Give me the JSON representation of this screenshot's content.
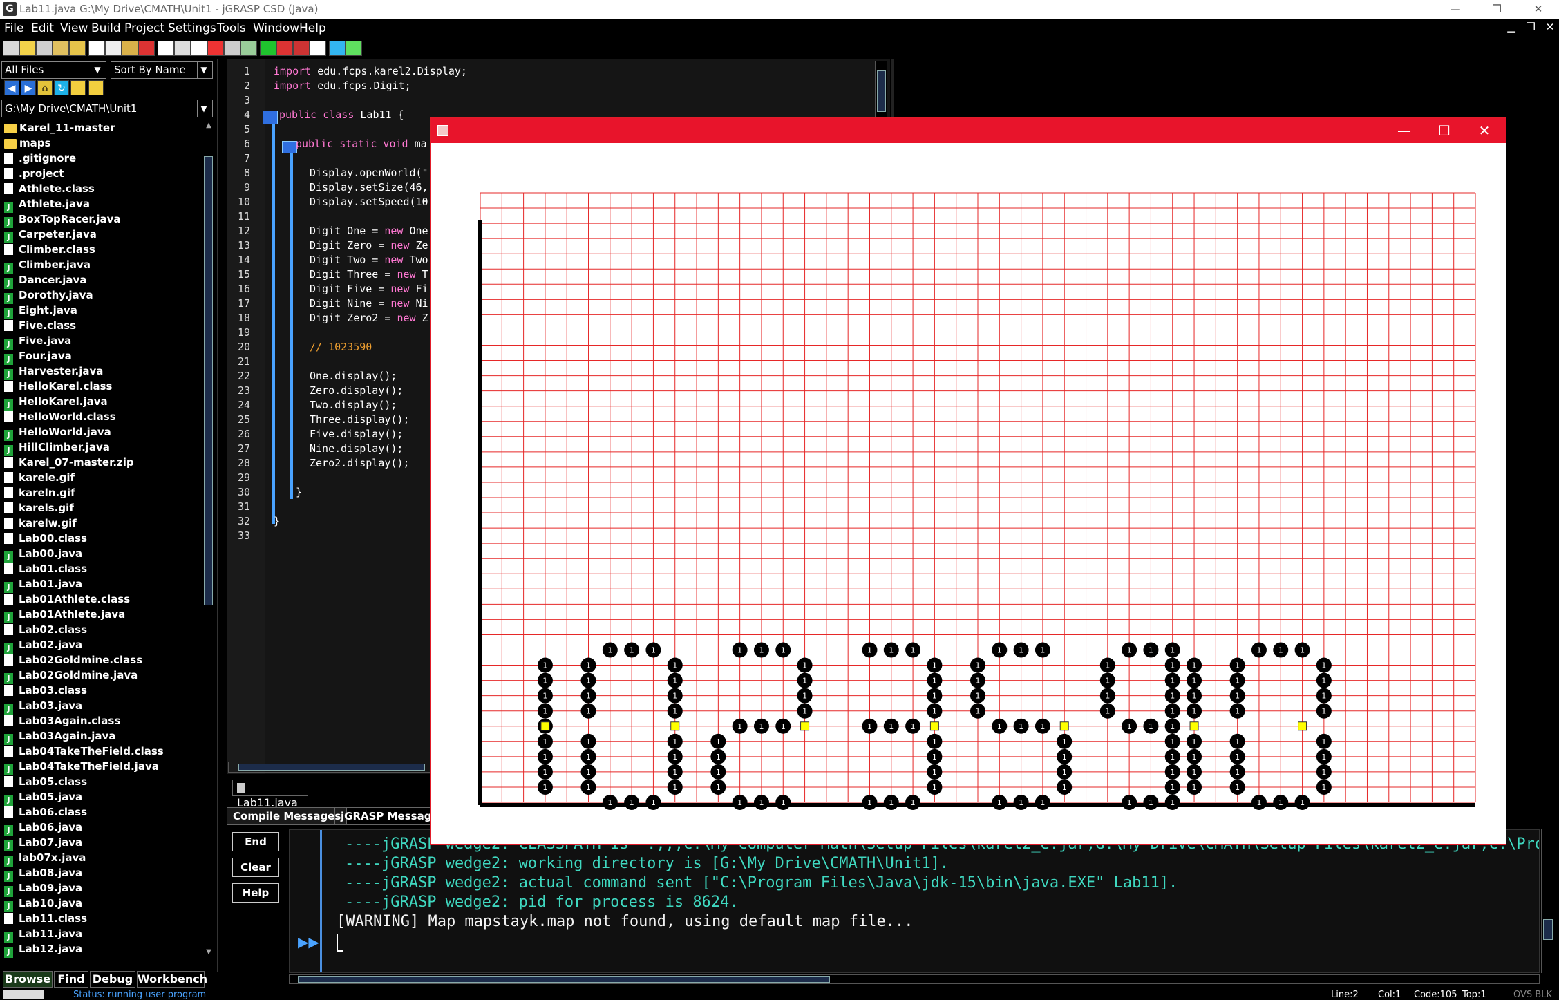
{
  "window": {
    "title": "Lab11.java  G:\\My Drive\\CMATH\\Unit1 - jGRASP CSD (Java)",
    "app_icon": "G",
    "min_icon": "minimize-icon",
    "max_icon": "maximize-icon",
    "close_icon": "close-icon"
  },
  "menu": [
    "File",
    "Edit",
    "View",
    "Build",
    "Project",
    "Settings",
    "Tools",
    "Window",
    "Help"
  ],
  "browse": {
    "filter": "All Files",
    "sort": "Sort By Name",
    "path": "G:\\My Drive\\CMATH\\Unit1",
    "files": [
      {
        "name": "Karel_11-master",
        "type": "folder"
      },
      {
        "name": "maps",
        "type": "folder"
      },
      {
        "name": ".gitignore",
        "type": "doc"
      },
      {
        "name": ".project",
        "type": "doc"
      },
      {
        "name": "Athlete.class",
        "type": "doc"
      },
      {
        "name": "Athlete.java",
        "type": "java"
      },
      {
        "name": "BoxTopRacer.java",
        "type": "java"
      },
      {
        "name": "Carpeter.java",
        "type": "java"
      },
      {
        "name": "Climber.class",
        "type": "doc"
      },
      {
        "name": "Climber.java",
        "type": "java"
      },
      {
        "name": "Dancer.java",
        "type": "java"
      },
      {
        "name": "Dorothy.java",
        "type": "java"
      },
      {
        "name": "Eight.java",
        "type": "java"
      },
      {
        "name": "Five.class",
        "type": "doc"
      },
      {
        "name": "Five.java",
        "type": "java"
      },
      {
        "name": "Four.java",
        "type": "java"
      },
      {
        "name": "Harvester.java",
        "type": "java"
      },
      {
        "name": "HelloKarel.class",
        "type": "doc"
      },
      {
        "name": "HelloKarel.java",
        "type": "java"
      },
      {
        "name": "HelloWorld.class",
        "type": "doc"
      },
      {
        "name": "HelloWorld.java",
        "type": "java"
      },
      {
        "name": "HillClimber.java",
        "type": "java"
      },
      {
        "name": "Karel_07-master.zip",
        "type": "doc"
      },
      {
        "name": "karele.gif",
        "type": "doc"
      },
      {
        "name": "kareln.gif",
        "type": "doc"
      },
      {
        "name": "karels.gif",
        "type": "doc"
      },
      {
        "name": "karelw.gif",
        "type": "doc"
      },
      {
        "name": "Lab00.class",
        "type": "doc"
      },
      {
        "name": "Lab00.java",
        "type": "java"
      },
      {
        "name": "Lab01.class",
        "type": "doc"
      },
      {
        "name": "Lab01.java",
        "type": "java"
      },
      {
        "name": "Lab01Athlete.class",
        "type": "doc"
      },
      {
        "name": "Lab01Athlete.java",
        "type": "java"
      },
      {
        "name": "Lab02.class",
        "type": "doc"
      },
      {
        "name": "Lab02.java",
        "type": "java"
      },
      {
        "name": "Lab02Goldmine.class",
        "type": "doc"
      },
      {
        "name": "Lab02Goldmine.java",
        "type": "java"
      },
      {
        "name": "Lab03.class",
        "type": "doc"
      },
      {
        "name": "Lab03.java",
        "type": "java"
      },
      {
        "name": "Lab03Again.class",
        "type": "doc"
      },
      {
        "name": "Lab03Again.java",
        "type": "java"
      },
      {
        "name": "Lab04TakeTheField.class",
        "type": "doc"
      },
      {
        "name": "Lab04TakeTheField.java",
        "type": "java"
      },
      {
        "name": "Lab05.class",
        "type": "doc"
      },
      {
        "name": "Lab05.java",
        "type": "java"
      },
      {
        "name": "Lab06.class",
        "type": "doc"
      },
      {
        "name": "Lab06.java",
        "type": "java"
      },
      {
        "name": "Lab07.java",
        "type": "java"
      },
      {
        "name": "lab07x.java",
        "type": "java"
      },
      {
        "name": "Lab08.java",
        "type": "java"
      },
      {
        "name": "Lab09.java",
        "type": "java"
      },
      {
        "name": "Lab10.java",
        "type": "java"
      },
      {
        "name": "Lab11.class",
        "type": "doc"
      },
      {
        "name": "Lab11.java",
        "type": "java"
      },
      {
        "name": "Lab12.java",
        "type": "java"
      }
    ]
  },
  "bottom_tabs": [
    "Browse",
    "Find",
    "Debug",
    "Workbench"
  ],
  "editor": {
    "tab_label": "Lab11.java",
    "lines": [
      [
        [
          "kw",
          "import"
        ],
        [
          "id",
          " edu.fcps.karel2.Display;"
        ]
      ],
      [
        [
          "kw",
          "import"
        ],
        [
          "id",
          " edu.fcps.Digit;"
        ]
      ],
      [],
      [
        [
          "kw",
          "public class"
        ],
        [
          "id",
          " Lab11 {"
        ]
      ],
      [],
      [
        [
          "kw",
          "public static void"
        ],
        [
          "id",
          " ma"
        ]
      ],
      [],
      [
        [
          "id",
          "Display.openWorld(\""
        ]
      ],
      [
        [
          "id",
          "Display.setSize(46,"
        ]
      ],
      [
        [
          "id",
          "Display.setSpeed(10"
        ]
      ],
      [],
      [
        [
          "id",
          "Digit One = "
        ],
        [
          "kw",
          "new"
        ],
        [
          "id",
          " One"
        ]
      ],
      [
        [
          "id",
          "Digit Zero = "
        ],
        [
          "kw",
          "new"
        ],
        [
          "id",
          " Ze"
        ]
      ],
      [
        [
          "id",
          "Digit Two = "
        ],
        [
          "kw",
          "new"
        ],
        [
          "id",
          " Two"
        ]
      ],
      [
        [
          "id",
          "Digit Three = "
        ],
        [
          "kw",
          "new"
        ],
        [
          "id",
          " T"
        ]
      ],
      [
        [
          "id",
          "Digit Five = "
        ],
        [
          "kw",
          "new"
        ],
        [
          "id",
          " Fi"
        ]
      ],
      [
        [
          "id",
          "Digit Nine = "
        ],
        [
          "kw",
          "new"
        ],
        [
          "id",
          " Ni"
        ]
      ],
      [
        [
          "id",
          "Digit Zero2 = "
        ],
        [
          "kw",
          "new"
        ],
        [
          "id",
          " Z"
        ]
      ],
      [],
      [
        [
          "cm",
          "// 1023590"
        ]
      ],
      [],
      [
        [
          "id",
          "One.display();"
        ]
      ],
      [
        [
          "id",
          "Zero.display();"
        ]
      ],
      [
        [
          "id",
          "Two.display();"
        ]
      ],
      [
        [
          "id",
          "Three.display();"
        ]
      ],
      [
        [
          "id",
          "Five.display();"
        ]
      ],
      [
        [
          "id",
          "Nine.display();"
        ]
      ],
      [
        [
          "id",
          "Zero2.display();"
        ]
      ],
      [],
      [
        [
          "id",
          "}"
        ]
      ],
      [],
      [
        [
          "id",
          "}"
        ]
      ],
      []
    ]
  },
  "messages": {
    "tabs": [
      "Compile Messages",
      "jGRASP Messages"
    ],
    "buttons": [
      "End",
      "Clear",
      "Help"
    ],
    "lines": [
      "----jGRASP wedge2: CLASSPATH is \".;;;C:\\My Computer Math\\Setup Files\\karel2_e.jar;G:\\My Drive\\CMATH\\Setup Files\\karel2_e.jar;C:\\Progr",
      "----jGRASP wedge2: working directory is [G:\\My Drive\\CMATH\\Unit1].",
      "----jGRASP wedge2: actual command sent [\"C:\\Program Files\\Java\\jdk-15\\bin\\java.EXE\" Lab11].",
      "----jGRASP wedge2: pid for process is 8624."
    ],
    "warning": "[WARNING] Map mapstayk.map not found, using default map file..."
  },
  "status": {
    "text": "Status: running user program",
    "line": "Line:2",
    "col": "Col:1",
    "code": "Code:105",
    "top": "Top:1",
    "mode": "OVS BLK"
  },
  "karel": {
    "beeper_label": "1",
    "colors": {
      "titlebar": "#e8142b",
      "grid": "#e62828",
      "beeper": "#000000",
      "robot": "#ffff00"
    },
    "digits_shown": "1023590"
  }
}
